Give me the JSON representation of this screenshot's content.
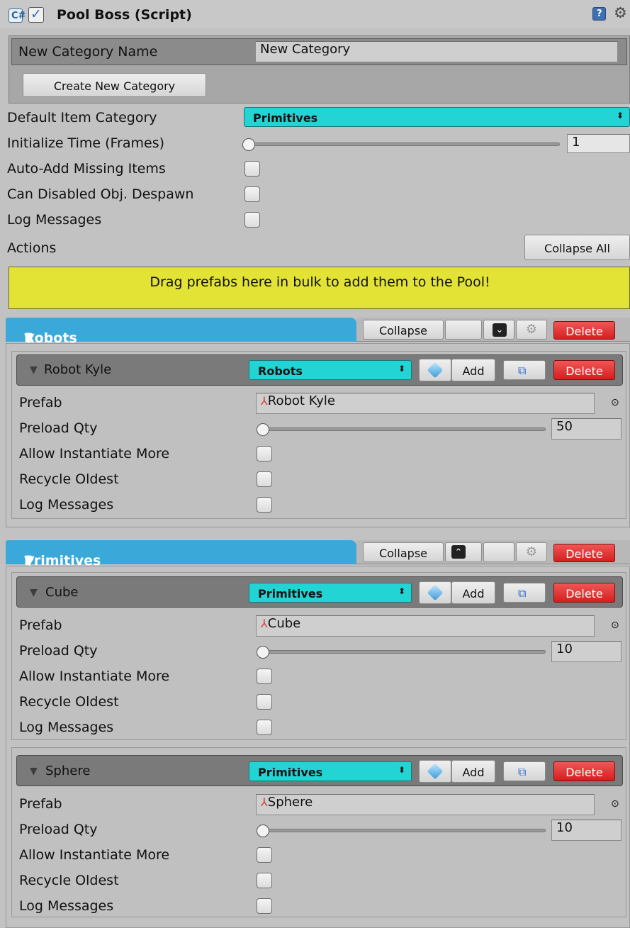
{
  "header": {
    "title": "Pool Boss (Script)"
  },
  "create_category": {
    "label": "New Category Name",
    "value": "New Category",
    "button": "Create New Category"
  },
  "settings": {
    "default_category_label": "Default Item Category",
    "default_category_value": "Primitives",
    "init_time_label": "Initialize Time (Frames)",
    "init_time_value": "1",
    "auto_add_label": "Auto-Add Missing Items",
    "can_disabled_label": "Can Disabled Obj. Despawn",
    "log_messages_label": "Log Messages",
    "actions_label": "Actions",
    "collapse_all": "Collapse All"
  },
  "drop_zone": "Drag prefabs here in bulk to add them to the Pool!",
  "categories": [
    {
      "name": "Robots",
      "collapse": "Collapse",
      "delete": "Delete",
      "items": [
        {
          "name": "Robot Kyle",
          "category": "Robots",
          "add": "Add",
          "delete": "Delete",
          "prefab_label": "Prefab",
          "prefab": "Robot Kyle",
          "preload_label": "Preload Qty",
          "preload": "50",
          "allow_more_label": "Allow Instantiate More",
          "recycle_label": "Recycle Oldest",
          "log_label": "Log Messages"
        }
      ]
    },
    {
      "name": "Primitives",
      "collapse": "Collapse",
      "delete": "Delete",
      "items": [
        {
          "name": "Cube",
          "category": "Primitives",
          "add": "Add",
          "delete": "Delete",
          "prefab_label": "Prefab",
          "prefab": "Cube",
          "preload_label": "Preload Qty",
          "preload": "10",
          "allow_more_label": "Allow Instantiate More",
          "recycle_label": "Recycle Oldest",
          "log_label": "Log Messages"
        },
        {
          "name": "Sphere",
          "category": "Primitives",
          "add": "Add",
          "delete": "Delete",
          "prefab_label": "Prefab",
          "prefab": "Sphere",
          "preload_label": "Preload Qty",
          "preload": "10",
          "allow_more_label": "Allow Instantiate More",
          "recycle_label": "Recycle Oldest",
          "log_label": "Log Messages"
        }
      ]
    }
  ],
  "colors": {
    "panel_bg": "#c2c2c2",
    "category_tab": "#3aa9da",
    "dropdown": "#22d4d4",
    "delete": "#d61e1e",
    "drop_zone": "#e3e336"
  }
}
